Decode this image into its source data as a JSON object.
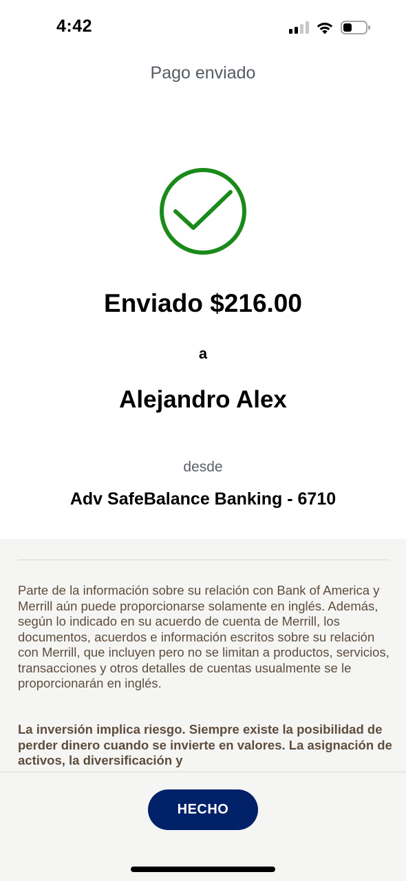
{
  "status_bar": {
    "time": "4:42",
    "icons": [
      "cellular-signal-icon",
      "wifi-icon",
      "battery-icon"
    ]
  },
  "header": {
    "title": "Pago enviado"
  },
  "confirmation": {
    "icon": "checkmark-circle-icon",
    "accent_color": "#1a8a1a",
    "amount_line": "Enviado $216.00",
    "to_label": "a",
    "recipient_name": "Alejandro Alex",
    "from_label": "desde",
    "from_account": "Adv SafeBalance Banking - 6710"
  },
  "disclosure": {
    "paragraph_1": "Parte de la información sobre su relación con Bank of America y Merrill aún puede proporcionarse solamente en inglés. Además, según lo indicado en su acuerdo de cuenta de Merrill, los documentos, acuerdos e información escritos sobre su relación con Merrill, que incluyen pero no se limitan a productos, servicios, transacciones y otros detalles de cuentas usualmente se le proporcionarán en inglés.",
    "paragraph_2": "La inversión implica riesgo. Siempre existe la posibilidad de perder dinero cuando se invierte en valores. La asignación de activos, la diversificación y"
  },
  "footer": {
    "done_label": "HECHO",
    "button_color": "#012169"
  }
}
